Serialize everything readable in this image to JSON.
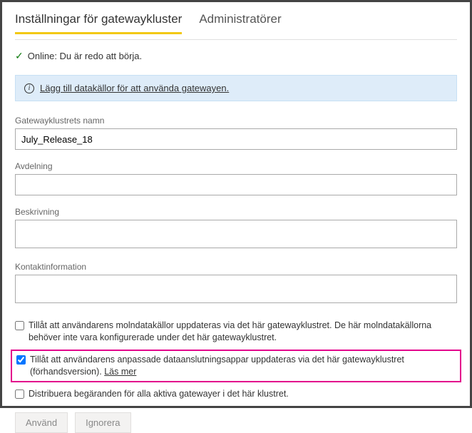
{
  "tabs": {
    "settings": "Inställningar för gatewaykluster",
    "admins": "Administratörer"
  },
  "status": {
    "text": "Online: Du är redo att börja."
  },
  "infoBanner": {
    "linkText": "Lägg till datakällor för att använda gatewayen."
  },
  "fields": {
    "clusterName": {
      "label": "Gatewayklustrets namn",
      "value": "July_Release_18"
    },
    "department": {
      "label": "Avdelning",
      "value": ""
    },
    "description": {
      "label": "Beskrivning",
      "value": ""
    },
    "contact": {
      "label": "Kontaktinformation",
      "value": ""
    }
  },
  "checkboxes": {
    "cloud": {
      "label": "Tillåt att användarens molndatakällor uppdateras via det här gatewayklustret. De här molndatakällorna behöver inte vara konfigurerade under det här gatewayklustret."
    },
    "custom": {
      "label": "Tillåt att användarens anpassade dataanslutningsappar uppdateras via det här gatewayklustret (förhandsversion).",
      "learnMore": "Läs mer"
    },
    "distribute": {
      "label": "Distribuera begäranden för alla aktiva gatewayer i det här klustret."
    }
  },
  "buttons": {
    "apply": "Använd",
    "discard": "Ignorera"
  }
}
